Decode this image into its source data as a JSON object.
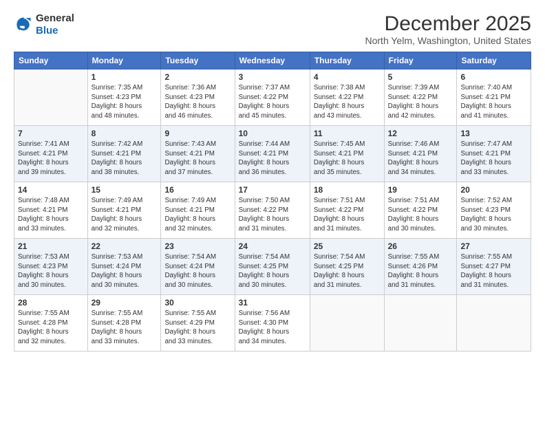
{
  "header": {
    "logo": {
      "general": "General",
      "blue": "Blue"
    },
    "month": "December 2025",
    "location": "North Yelm, Washington, United States"
  },
  "days_of_week": [
    "Sunday",
    "Monday",
    "Tuesday",
    "Wednesday",
    "Thursday",
    "Friday",
    "Saturday"
  ],
  "weeks": [
    [
      {
        "day": "",
        "info": ""
      },
      {
        "day": "1",
        "info": "Sunrise: 7:35 AM\nSunset: 4:23 PM\nDaylight: 8 hours\nand 48 minutes."
      },
      {
        "day": "2",
        "info": "Sunrise: 7:36 AM\nSunset: 4:23 PM\nDaylight: 8 hours\nand 46 minutes."
      },
      {
        "day": "3",
        "info": "Sunrise: 7:37 AM\nSunset: 4:22 PM\nDaylight: 8 hours\nand 45 minutes."
      },
      {
        "day": "4",
        "info": "Sunrise: 7:38 AM\nSunset: 4:22 PM\nDaylight: 8 hours\nand 43 minutes."
      },
      {
        "day": "5",
        "info": "Sunrise: 7:39 AM\nSunset: 4:22 PM\nDaylight: 8 hours\nand 42 minutes."
      },
      {
        "day": "6",
        "info": "Sunrise: 7:40 AM\nSunset: 4:21 PM\nDaylight: 8 hours\nand 41 minutes."
      }
    ],
    [
      {
        "day": "7",
        "info": "Sunrise: 7:41 AM\nSunset: 4:21 PM\nDaylight: 8 hours\nand 39 minutes."
      },
      {
        "day": "8",
        "info": "Sunrise: 7:42 AM\nSunset: 4:21 PM\nDaylight: 8 hours\nand 38 minutes."
      },
      {
        "day": "9",
        "info": "Sunrise: 7:43 AM\nSunset: 4:21 PM\nDaylight: 8 hours\nand 37 minutes."
      },
      {
        "day": "10",
        "info": "Sunrise: 7:44 AM\nSunset: 4:21 PM\nDaylight: 8 hours\nand 36 minutes."
      },
      {
        "day": "11",
        "info": "Sunrise: 7:45 AM\nSunset: 4:21 PM\nDaylight: 8 hours\nand 35 minutes."
      },
      {
        "day": "12",
        "info": "Sunrise: 7:46 AM\nSunset: 4:21 PM\nDaylight: 8 hours\nand 34 minutes."
      },
      {
        "day": "13",
        "info": "Sunrise: 7:47 AM\nSunset: 4:21 PM\nDaylight: 8 hours\nand 33 minutes."
      }
    ],
    [
      {
        "day": "14",
        "info": "Sunrise: 7:48 AM\nSunset: 4:21 PM\nDaylight: 8 hours\nand 33 minutes."
      },
      {
        "day": "15",
        "info": "Sunrise: 7:49 AM\nSunset: 4:21 PM\nDaylight: 8 hours\nand 32 minutes."
      },
      {
        "day": "16",
        "info": "Sunrise: 7:49 AM\nSunset: 4:21 PM\nDaylight: 8 hours\nand 32 minutes."
      },
      {
        "day": "17",
        "info": "Sunrise: 7:50 AM\nSunset: 4:22 PM\nDaylight: 8 hours\nand 31 minutes."
      },
      {
        "day": "18",
        "info": "Sunrise: 7:51 AM\nSunset: 4:22 PM\nDaylight: 8 hours\nand 31 minutes."
      },
      {
        "day": "19",
        "info": "Sunrise: 7:51 AM\nSunset: 4:22 PM\nDaylight: 8 hours\nand 30 minutes."
      },
      {
        "day": "20",
        "info": "Sunrise: 7:52 AM\nSunset: 4:23 PM\nDaylight: 8 hours\nand 30 minutes."
      }
    ],
    [
      {
        "day": "21",
        "info": "Sunrise: 7:53 AM\nSunset: 4:23 PM\nDaylight: 8 hours\nand 30 minutes."
      },
      {
        "day": "22",
        "info": "Sunrise: 7:53 AM\nSunset: 4:24 PM\nDaylight: 8 hours\nand 30 minutes."
      },
      {
        "day": "23",
        "info": "Sunrise: 7:54 AM\nSunset: 4:24 PM\nDaylight: 8 hours\nand 30 minutes."
      },
      {
        "day": "24",
        "info": "Sunrise: 7:54 AM\nSunset: 4:25 PM\nDaylight: 8 hours\nand 30 minutes."
      },
      {
        "day": "25",
        "info": "Sunrise: 7:54 AM\nSunset: 4:25 PM\nDaylight: 8 hours\nand 31 minutes."
      },
      {
        "day": "26",
        "info": "Sunrise: 7:55 AM\nSunset: 4:26 PM\nDaylight: 8 hours\nand 31 minutes."
      },
      {
        "day": "27",
        "info": "Sunrise: 7:55 AM\nSunset: 4:27 PM\nDaylight: 8 hours\nand 31 minutes."
      }
    ],
    [
      {
        "day": "28",
        "info": "Sunrise: 7:55 AM\nSunset: 4:28 PM\nDaylight: 8 hours\nand 32 minutes."
      },
      {
        "day": "29",
        "info": "Sunrise: 7:55 AM\nSunset: 4:28 PM\nDaylight: 8 hours\nand 33 minutes."
      },
      {
        "day": "30",
        "info": "Sunrise: 7:55 AM\nSunset: 4:29 PM\nDaylight: 8 hours\nand 33 minutes."
      },
      {
        "day": "31",
        "info": "Sunrise: 7:56 AM\nSunset: 4:30 PM\nDaylight: 8 hours\nand 34 minutes."
      },
      {
        "day": "",
        "info": ""
      },
      {
        "day": "",
        "info": ""
      },
      {
        "day": "",
        "info": ""
      }
    ]
  ]
}
